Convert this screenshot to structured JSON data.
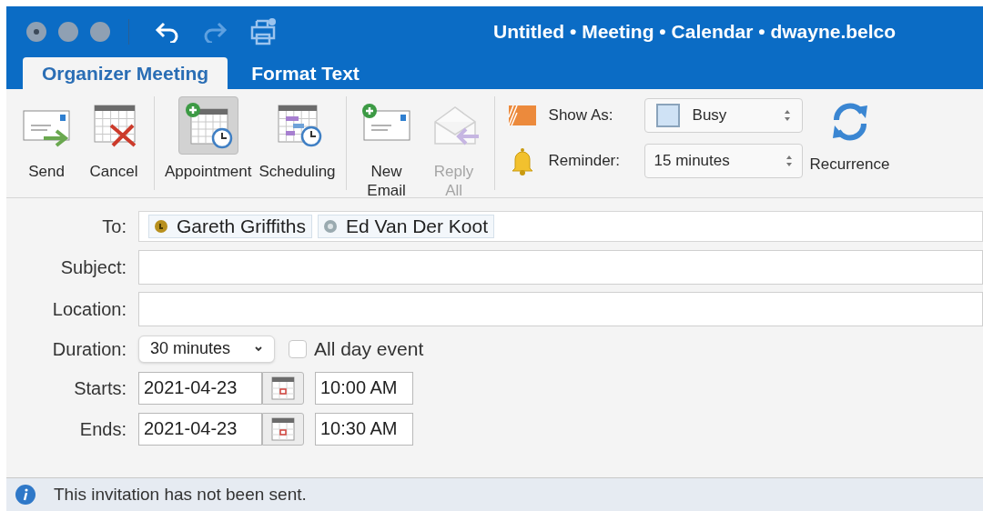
{
  "window": {
    "title": "Untitled • Meeting • Calendar • dwayne.belco"
  },
  "tabs": [
    {
      "label": "Organizer Meeting",
      "selected": true
    },
    {
      "label": "Format Text",
      "selected": false
    }
  ],
  "ribbon": {
    "groups": [
      [
        {
          "kind": "send",
          "label": "Send",
          "selected": false,
          "disabled": false
        },
        {
          "kind": "cancel",
          "label": "Cancel",
          "selected": false,
          "disabled": false
        }
      ],
      [
        {
          "kind": "appointment",
          "label": "Appointment",
          "selected": true,
          "disabled": false
        },
        {
          "kind": "scheduling",
          "label": "Scheduling",
          "selected": false,
          "disabled": false
        }
      ],
      [
        {
          "kind": "new-email",
          "label": "New Email",
          "selected": false,
          "disabled": false
        },
        {
          "kind": "reply-all",
          "label": "Reply All",
          "selected": false,
          "disabled": true
        }
      ]
    ],
    "show_as": {
      "label": "Show As:",
      "value": "Busy"
    },
    "reminder": {
      "label": "Reminder:",
      "value": "15 minutes"
    },
    "recurrence": {
      "label": "Recurrence"
    }
  },
  "form": {
    "to": {
      "label": "To:",
      "recipients": [
        {
          "name": "Gareth Griffiths",
          "kind": "accepted",
          "color": "#b8901e"
        },
        {
          "name": "Ed Van Der Koot",
          "kind": "none",
          "color": "#9aaab0"
        }
      ]
    },
    "subject": {
      "label": "Subject:"
    },
    "location": {
      "label": "Location:"
    },
    "duration": {
      "label": "Duration:",
      "value": "30 minutes"
    },
    "all_day": {
      "label": "All day event",
      "checked": false
    },
    "starts": {
      "label": "Starts:",
      "date": "2021-04-23",
      "time": "10:00 AM"
    },
    "ends": {
      "label": "Ends:",
      "date": "2021-04-23",
      "time": "10:30 AM"
    }
  },
  "status_bar": {
    "message": "This invitation has not been sent."
  }
}
